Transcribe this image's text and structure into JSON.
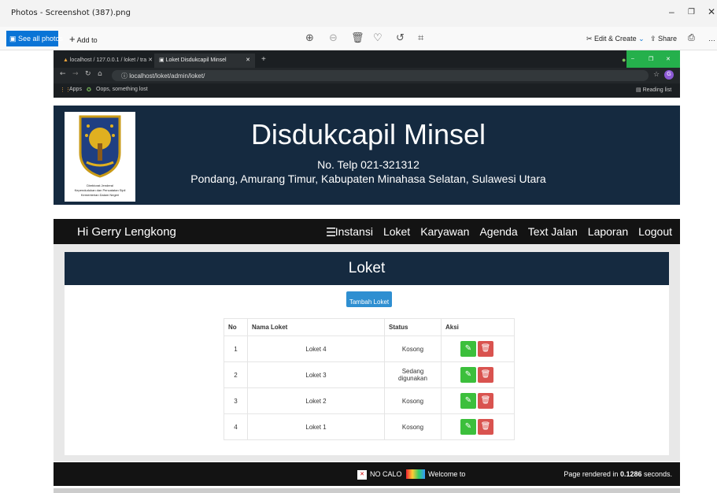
{
  "viewer": {
    "title": "Photos - Screenshot (387).png",
    "see_all": "See all photos",
    "add_to": "Add to",
    "edit_create": "Edit & Create",
    "share": "Share"
  },
  "browser": {
    "tabs": [
      {
        "label": "localhost / 127.0.0.1 / loket / tra"
      },
      {
        "label": "Loket Disdukcapil Minsel"
      }
    ],
    "url": "localhost/loket/admin/loket/",
    "bookmarks": [
      {
        "label": "Apps"
      },
      {
        "label": "Oops, something lost"
      }
    ],
    "reading_list": "Reading list"
  },
  "header": {
    "title": "Disdukcapil Minsel",
    "phone": "No. Telp 021-321312",
    "address": "Pondang, Amurang Timur, Kabupaten Minahasa Selatan, Sulawesi Utara",
    "logo_text": [
      "Direktorat Jenderal",
      "Kependudukan dan Pencatatan Sipil",
      "Kementerian Dalam Negeri"
    ]
  },
  "nav": {
    "greeting": "Hi Gerry Lengkong",
    "links": [
      "Instansi",
      "Loket",
      "Karyawan",
      "Agenda",
      "Text Jalan",
      "Laporan",
      "Logout"
    ]
  },
  "page": {
    "heading": "Loket",
    "add_button": "Tambah Loket"
  },
  "table": {
    "headers": [
      "No",
      "Nama Loket",
      "Status",
      "Aksi"
    ],
    "rows": [
      {
        "no": "1",
        "name": "Loket 4",
        "status": "Kosong"
      },
      {
        "no": "2",
        "name": "Loket 3",
        "status": "Sedang digunakan"
      },
      {
        "no": "3",
        "name": "Loket 2",
        "status": "Kosong"
      },
      {
        "no": "4",
        "name": "Loket 1",
        "status": "Kosong"
      }
    ]
  },
  "footer": {
    "brand": "NO CALO",
    "welcome": "Welcome to",
    "rendered_prefix": "Page rendered in ",
    "rendered_time": "0.1286",
    "rendered_suffix": " seconds."
  },
  "colors": {
    "header_bg": "#152a40",
    "nav_bg": "#131313",
    "edit_button": "#3cbf3c",
    "delete_button": "#d9534f",
    "primary_button": "#2f8fd1"
  }
}
